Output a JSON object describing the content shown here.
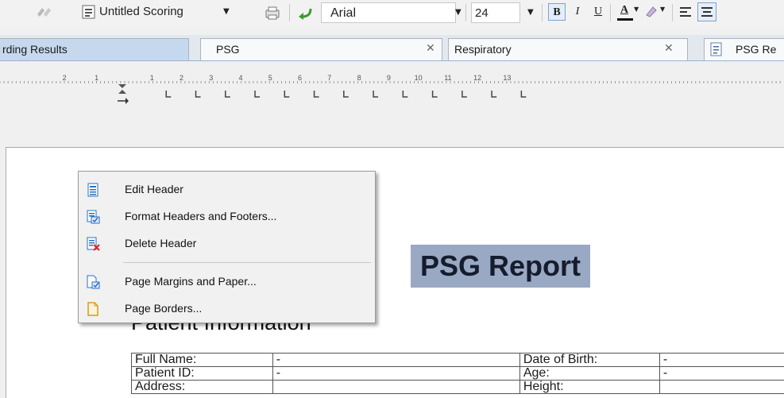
{
  "toolbar": {
    "template_name": "Untitled Scoring",
    "font_name": "Arial",
    "font_size": "24",
    "bold": "B",
    "italic": "I",
    "underline": "U",
    "font_color": "A"
  },
  "tabs": [
    {
      "label": "rding Results",
      "active": true,
      "closable": false
    },
    {
      "label": "PSG",
      "active": false,
      "closable": true
    },
    {
      "label": "Respiratory",
      "active": false,
      "closable": true
    },
    {
      "label": "PSG Re",
      "active": false,
      "closable": false
    }
  ],
  "ruler": {
    "labels": [
      "2",
      "1",
      "1",
      "2",
      "3",
      "4",
      "5",
      "6",
      "7",
      "8",
      "9",
      "10",
      "11",
      "12",
      "13"
    ]
  },
  "context_menu": {
    "items": [
      {
        "label": "Edit Header",
        "icon": "header-page-icon"
      },
      {
        "label": "Format Headers and Footers...",
        "icon": "format-headers-icon"
      },
      {
        "label": "Delete Header",
        "icon": "delete-header-icon"
      },
      {
        "label": "Page Margins and Paper...",
        "icon": "page-margins-icon"
      },
      {
        "label": "Page Borders...",
        "icon": "page-borders-icon"
      }
    ]
  },
  "document": {
    "title": "PSG Report",
    "section_heading": "Patient Information",
    "table": {
      "rows": [
        [
          "Full Name:",
          "-",
          "Date of Birth:",
          "-"
        ],
        [
          "Patient ID:",
          "-",
          "Age:",
          "-"
        ],
        [
          "Address:",
          "",
          "Height:",
          ""
        ]
      ]
    }
  },
  "colors": {
    "title_highlight": "#99a8c3",
    "active_tab": "#c5d8ee",
    "menu_background": "#f1f1f1"
  }
}
